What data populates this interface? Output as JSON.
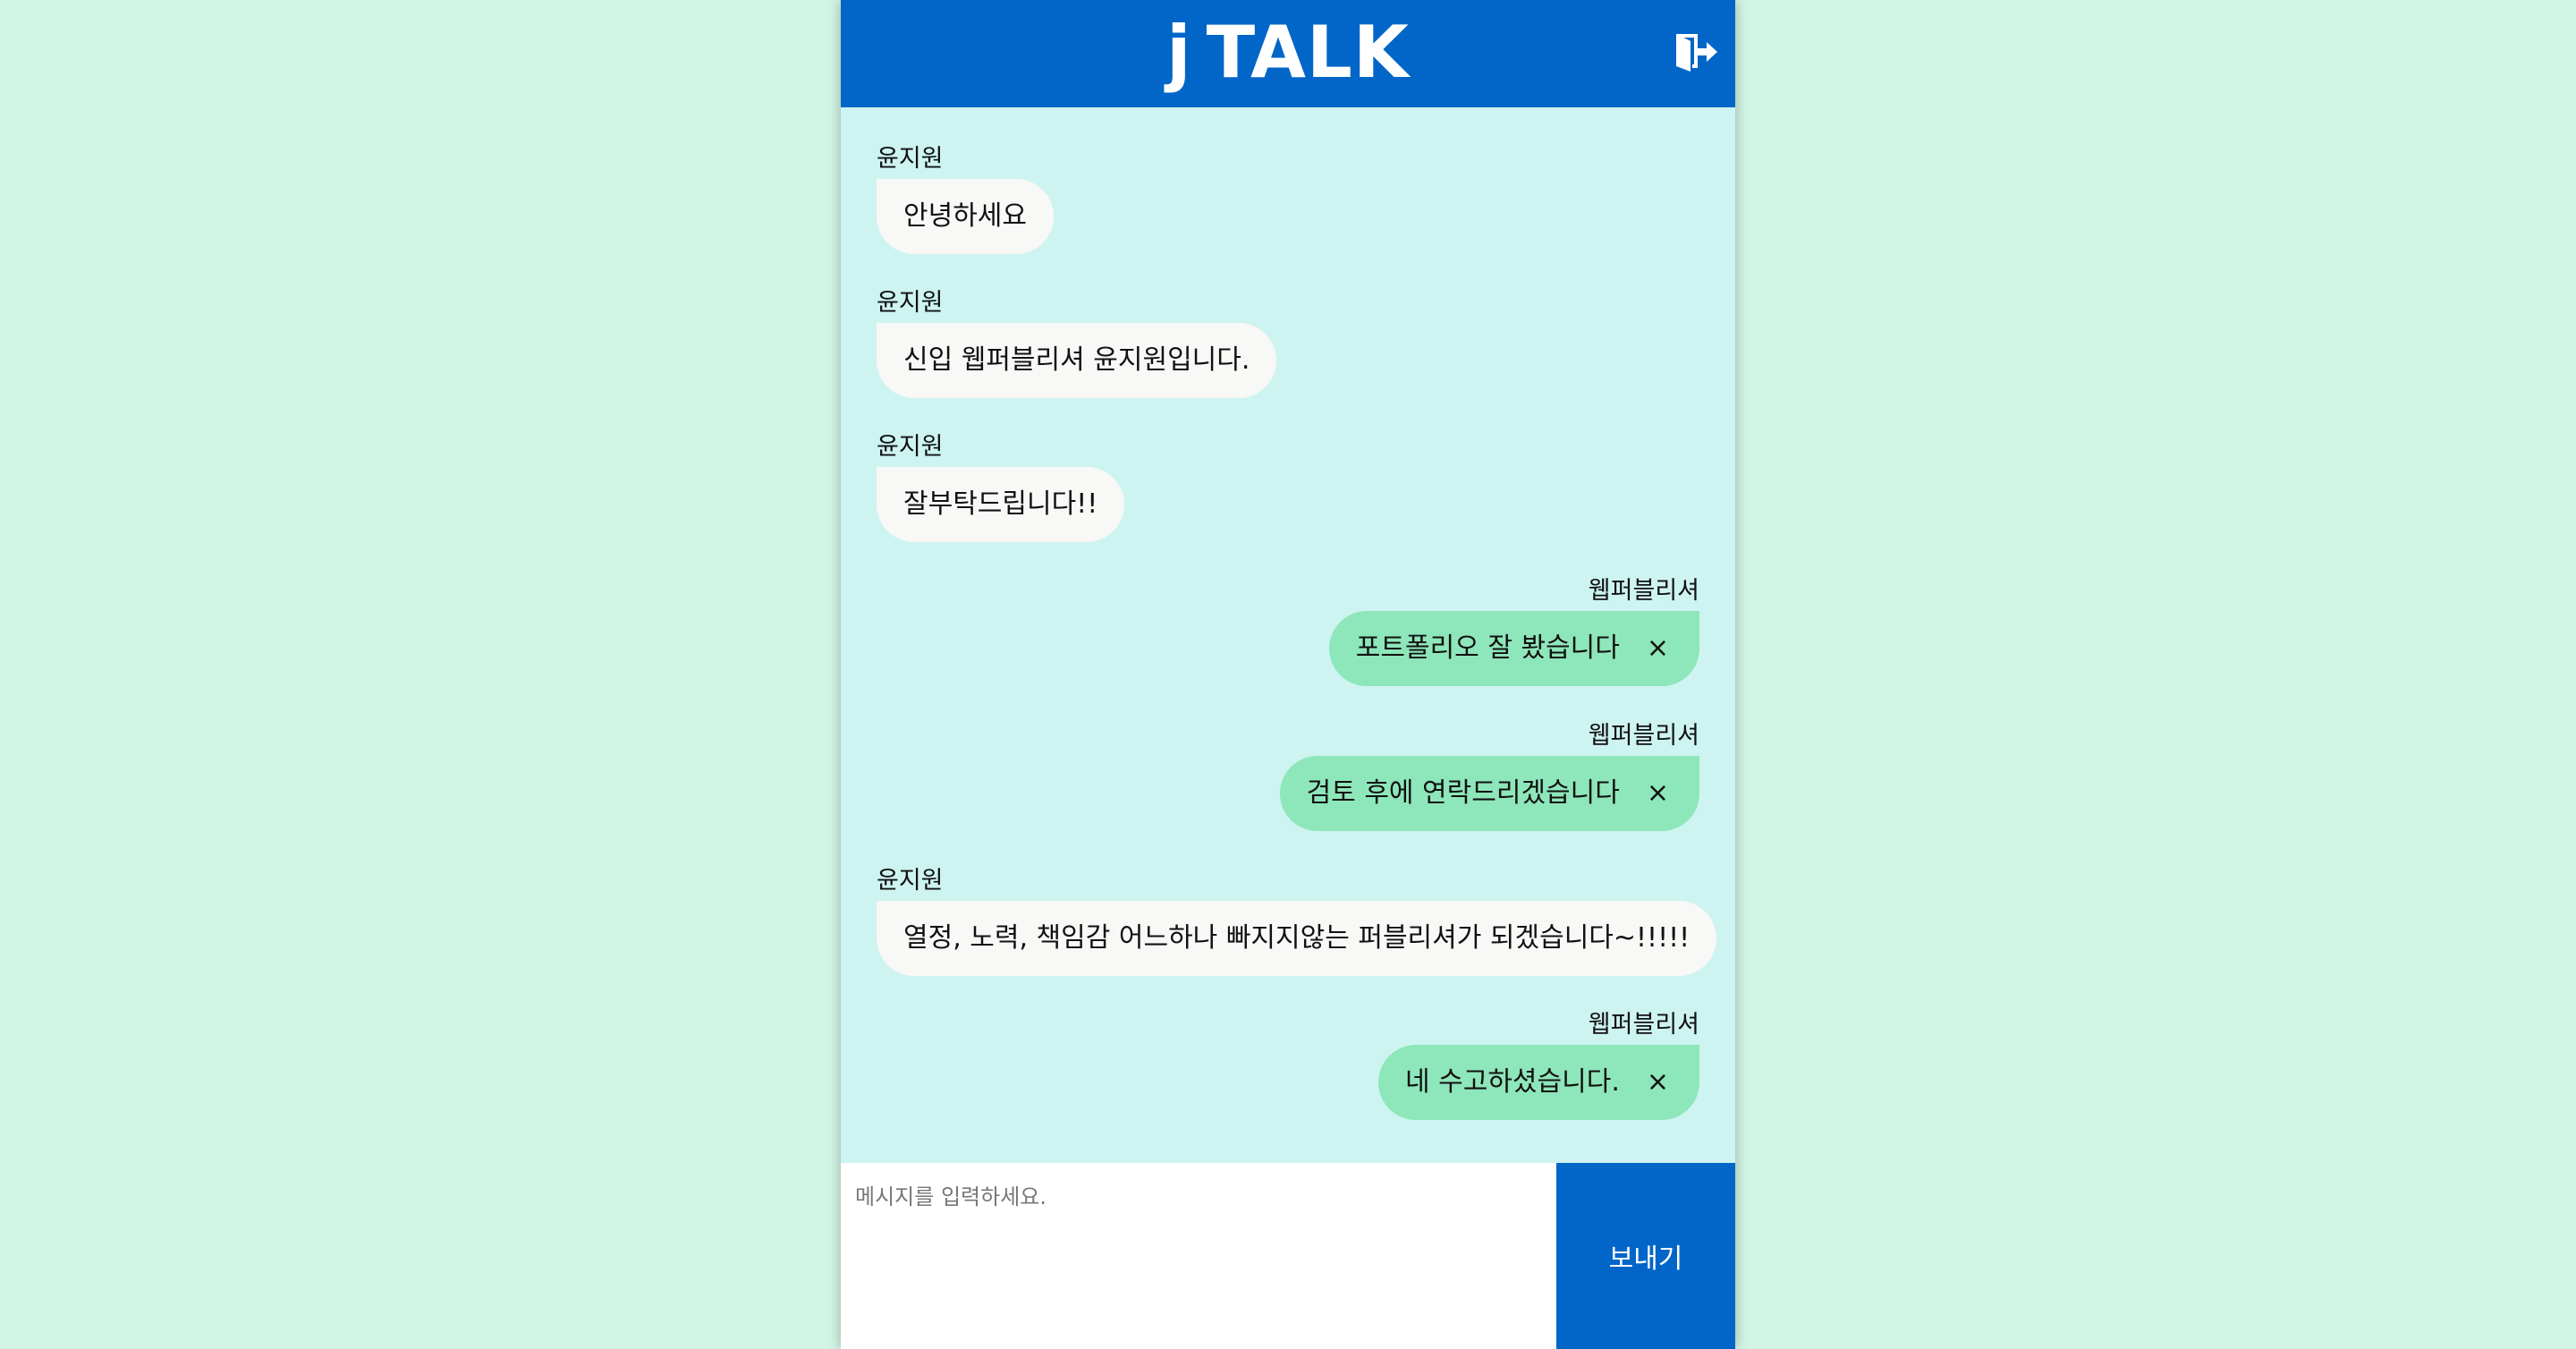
{
  "header": {
    "logo_j": "j",
    "logo_talk": "TALK",
    "exit_icon": "exit-door-icon",
    "color": "#0166c8"
  },
  "messages": [
    {
      "side": "left",
      "sender": "윤지원",
      "text": "안녕하세요"
    },
    {
      "side": "left",
      "sender": "윤지원",
      "text": "신입 웹퍼블리셔 윤지원입니다."
    },
    {
      "side": "left",
      "sender": "윤지원",
      "text": "잘부탁드립니다!!"
    },
    {
      "side": "right",
      "sender": "웹퍼블리셔",
      "text": "포트폴리오 잘 봤습니다",
      "delete": "×"
    },
    {
      "side": "right",
      "sender": "웹퍼블리셔",
      "text": "검토 후에 연락드리겠습니다",
      "delete": "×"
    },
    {
      "side": "left",
      "sender": "윤지원",
      "text": "열정, 노력, 책임감 어느하나 빠지지않는 퍼블리셔가 되겠습니다~!!!!!"
    },
    {
      "side": "right",
      "sender": "웹퍼블리셔",
      "text": "네 수고하셨습니다.",
      "delete": "×"
    }
  ],
  "composer": {
    "placeholder": "메시지를 입력하세요.",
    "value": "",
    "send_label": "보내기"
  },
  "colors": {
    "page_bg": "#d2f4e4",
    "chat_bg": "#cdf4f1",
    "my_bubble": "#8ee6bb",
    "their_bubble": "#f8f8f6"
  }
}
